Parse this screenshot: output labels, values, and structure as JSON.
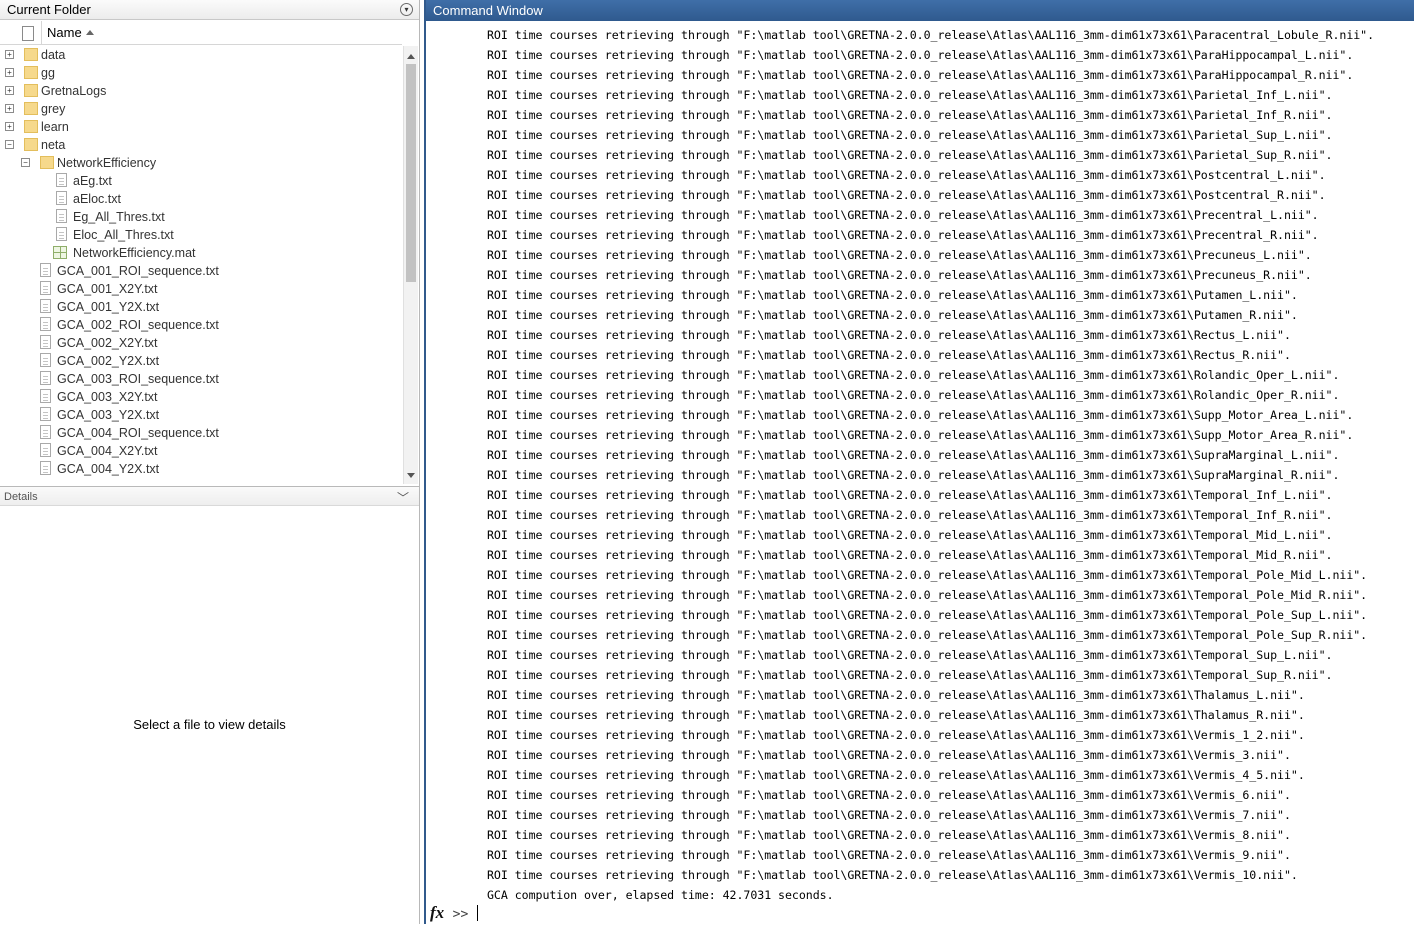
{
  "left": {
    "title": "Current Folder",
    "column_name": "Name",
    "tree": [
      {
        "label": "data",
        "kind": "folder",
        "level": 0,
        "expander": "+"
      },
      {
        "label": "gg",
        "kind": "folder",
        "level": 0,
        "expander": "+"
      },
      {
        "label": "GretnaLogs",
        "kind": "folder",
        "level": 0,
        "expander": "+"
      },
      {
        "label": "grey",
        "kind": "folder",
        "level": 0,
        "expander": "+"
      },
      {
        "label": "learn",
        "kind": "folder",
        "level": 0,
        "expander": "+"
      },
      {
        "label": "neta",
        "kind": "folder",
        "level": 0,
        "expander": "−"
      },
      {
        "label": "NetworkEfficiency",
        "kind": "folder",
        "level": 1,
        "expander": "−"
      },
      {
        "label": "aEg.txt",
        "kind": "file",
        "level": 2
      },
      {
        "label": "aEloc.txt",
        "kind": "file",
        "level": 2
      },
      {
        "label": "Eg_All_Thres.txt",
        "kind": "file",
        "level": 2
      },
      {
        "label": "Eloc_All_Thres.txt",
        "kind": "file",
        "level": 2
      },
      {
        "label": "NetworkEfficiency.mat",
        "kind": "mat",
        "level": 2
      },
      {
        "label": "GCA_001_ROI_sequence.txt",
        "kind": "file",
        "level": 1
      },
      {
        "label": "GCA_001_X2Y.txt",
        "kind": "file",
        "level": 1
      },
      {
        "label": "GCA_001_Y2X.txt",
        "kind": "file",
        "level": 1
      },
      {
        "label": "GCA_002_ROI_sequence.txt",
        "kind": "file",
        "level": 1
      },
      {
        "label": "GCA_002_X2Y.txt",
        "kind": "file",
        "level": 1
      },
      {
        "label": "GCA_002_Y2X.txt",
        "kind": "file",
        "level": 1
      },
      {
        "label": "GCA_003_ROI_sequence.txt",
        "kind": "file",
        "level": 1
      },
      {
        "label": "GCA_003_X2Y.txt",
        "kind": "file",
        "level": 1
      },
      {
        "label": "GCA_003_Y2X.txt",
        "kind": "file",
        "level": 1
      },
      {
        "label": "GCA_004_ROI_sequence.txt",
        "kind": "file",
        "level": 1
      },
      {
        "label": "GCA_004_X2Y.txt",
        "kind": "file",
        "level": 1
      },
      {
        "label": "GCA_004_Y2X.txt",
        "kind": "file",
        "level": 1
      }
    ],
    "details_title": "Details",
    "details_message": "Select a file to view details"
  },
  "command_window": {
    "title": "Command Window",
    "prefix": "ROI time courses retrieving through \"F:\\matlab tool\\GRETNA-2.0.0_release\\Atlas\\AAL116_3mm-dim61x73x61\\",
    "suffix": "\".",
    "lines": [
      "Paracentral_Lobule_R.nii",
      "ParaHippocampal_L.nii",
      "ParaHippocampal_R.nii",
      "Parietal_Inf_L.nii",
      "Parietal_Inf_R.nii",
      "Parietal_Sup_L.nii",
      "Parietal_Sup_R.nii",
      "Postcentral_L.nii",
      "Postcentral_R.nii",
      "Precentral_L.nii",
      "Precentral_R.nii",
      "Precuneus_L.nii",
      "Precuneus_R.nii",
      "Putamen_L.nii",
      "Putamen_R.nii",
      "Rectus_L.nii",
      "Rectus_R.nii",
      "Rolandic_Oper_L.nii",
      "Rolandic_Oper_R.nii",
      "Supp_Motor_Area_L.nii",
      "Supp_Motor_Area_R.nii",
      "SupraMarginal_L.nii",
      "SupraMarginal_R.nii",
      "Temporal_Inf_L.nii",
      "Temporal_Inf_R.nii",
      "Temporal_Mid_L.nii",
      "Temporal_Mid_R.nii",
      "Temporal_Pole_Mid_L.nii",
      "Temporal_Pole_Mid_R.nii",
      "Temporal_Pole_Sup_L.nii",
      "Temporal_Pole_Sup_R.nii",
      "Temporal_Sup_L.nii",
      "Temporal_Sup_R.nii",
      "Thalamus_L.nii",
      "Thalamus_R.nii",
      "Vermis_1_2.nii",
      "Vermis_3.nii",
      "Vermis_4_5.nii",
      "Vermis_6.nii",
      "Vermis_7.nii",
      "Vermis_8.nii",
      "Vermis_9.nii",
      "Vermis_10.nii"
    ],
    "final_line": "GCA compution over, elapsed time: 42.7031 seconds.",
    "prompt_fx": "fx",
    "prompt_symbol": ">>"
  }
}
